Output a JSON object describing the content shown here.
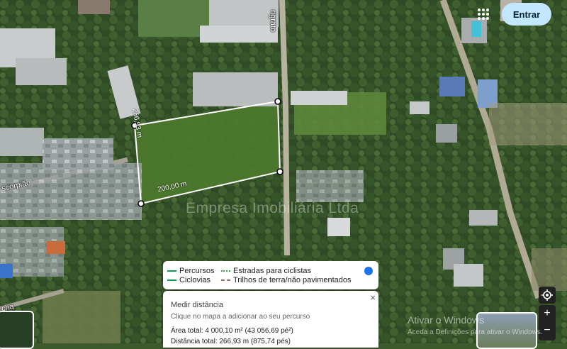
{
  "map": {
    "road_labels": {
      "north": "rigrato",
      "west": "scorpião",
      "southwest": "cha"
    },
    "measure_labels": {
      "side": "266,93 m",
      "bottom": "200,00 m"
    },
    "watermark": "Empresa Imobiliária Ltda"
  },
  "header": {
    "signin_label": "Entrar",
    "apps_icon": "apps-grid-icon"
  },
  "legend": {
    "items": [
      {
        "label": "Percursos",
        "style": "solid",
        "color": "#0f9d58"
      },
      {
        "label": "Estradas para ciclistas",
        "style": "dotted",
        "color": "#34a853"
      },
      {
        "label": "Ciclovias",
        "style": "solid",
        "color": "#0f9d58"
      },
      {
        "label": "Trilhos de terra/não pavimentados",
        "style": "dashed",
        "color": "#8d6e63"
      }
    ],
    "toggle_color": "#1a73e8"
  },
  "measure": {
    "title": "Medir distância",
    "hint": "Clique no mapa a adicionar ao seu percurso",
    "area": "Área total: 4 000,10 m² (43 056,69 pé²)",
    "distance": "Distância total: 266,93 m (875,74 pés)",
    "close": "×"
  },
  "controls": {
    "locate_icon": "my-location-icon",
    "zoom_in": "+",
    "zoom_out": "−"
  },
  "overlay": {
    "activate_title": "Ativar o Windows",
    "activate_hint": "Aceda a Definições para ativar o Windows."
  }
}
